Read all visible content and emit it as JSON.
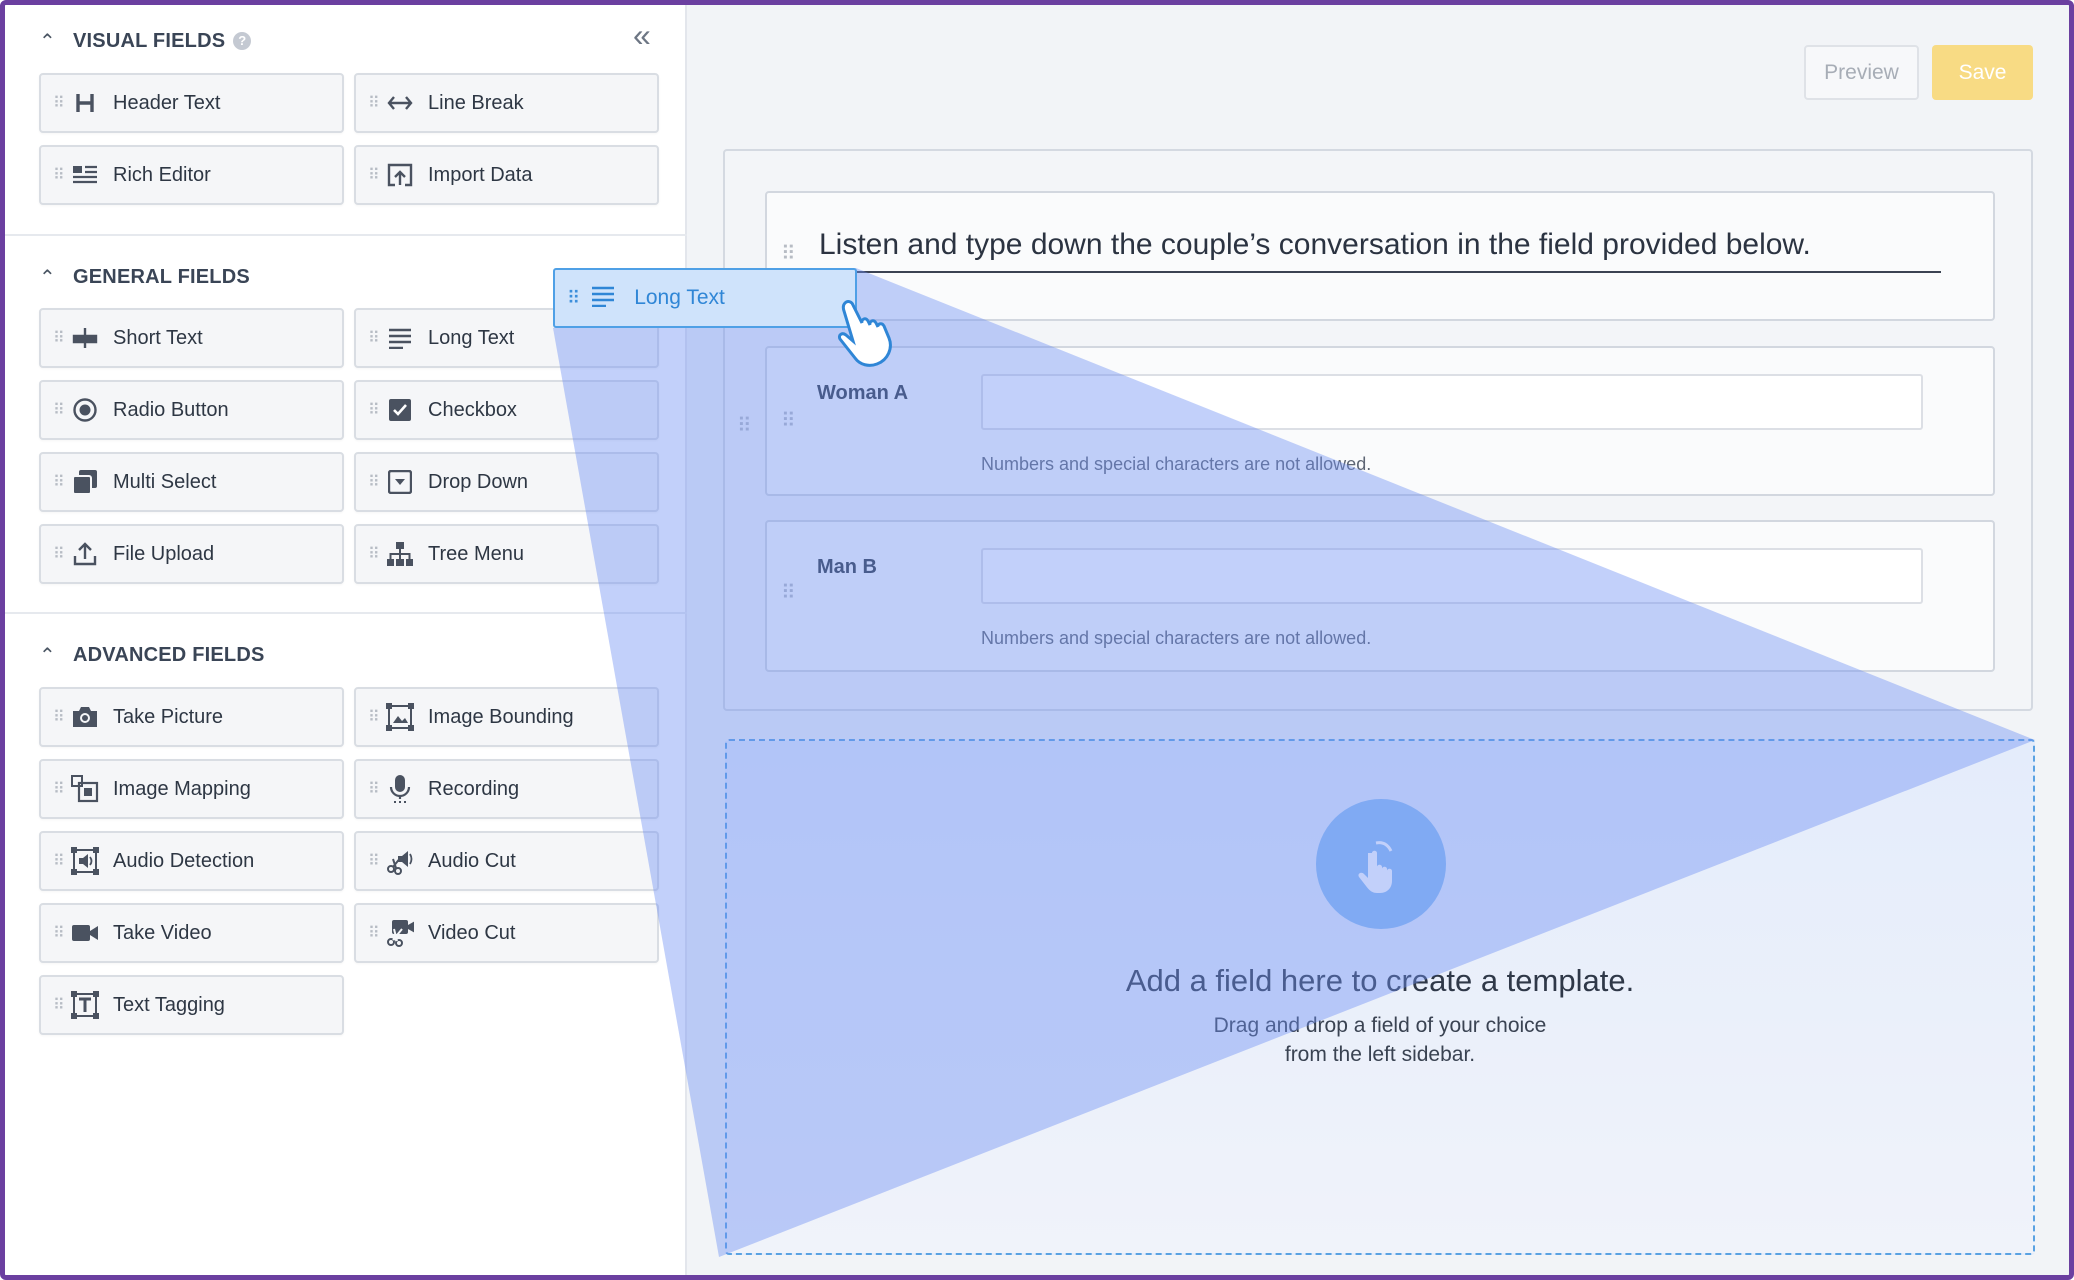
{
  "sidebar": {
    "collapse_icon": "double-chevron-left-icon",
    "visual": {
      "title": "VISUAL FIELDS",
      "help": "?",
      "items": [
        {
          "label": "Header Text",
          "icon": "header-icon"
        },
        {
          "label": "Line Break",
          "icon": "line-break-icon"
        },
        {
          "label": "Rich Editor",
          "icon": "rich-editor-icon"
        },
        {
          "label": "Import Data",
          "icon": "import-data-icon"
        }
      ]
    },
    "general": {
      "title": "GENERAL FIELDS",
      "items": [
        {
          "label": "Short Text",
          "icon": "short-text-icon"
        },
        {
          "label": "Long Text",
          "icon": "long-text-icon"
        },
        {
          "label": "Radio Button",
          "icon": "radio-icon"
        },
        {
          "label": "Checkbox",
          "icon": "checkbox-icon"
        },
        {
          "label": "Multi Select",
          "icon": "multi-select-icon"
        },
        {
          "label": "Drop Down",
          "icon": "drop-down-icon"
        },
        {
          "label": "File Upload",
          "icon": "file-upload-icon"
        },
        {
          "label": "Tree Menu",
          "icon": "tree-menu-icon"
        }
      ]
    },
    "advanced": {
      "title": "ADVANCED FIELDS",
      "items": [
        {
          "label": "Take Picture",
          "icon": "camera-icon"
        },
        {
          "label": "Image Bounding",
          "icon": "image-bounding-icon"
        },
        {
          "label": "Image Mapping",
          "icon": "image-mapping-icon"
        },
        {
          "label": "Recording",
          "icon": "microphone-icon"
        },
        {
          "label": "Audio Detection",
          "icon": "audio-detection-icon"
        },
        {
          "label": "Audio Cut",
          "icon": "audio-cut-icon"
        },
        {
          "label": "Take Video",
          "icon": "video-camera-icon"
        },
        {
          "label": "Video Cut",
          "icon": "video-cut-icon"
        },
        {
          "label": "Text Tagging",
          "icon": "text-tagging-icon"
        }
      ]
    }
  },
  "toolbar": {
    "preview_label": "Preview",
    "save_label": "Save"
  },
  "form": {
    "header_text": "Listen and type down the couple’s conversation in the field provided below.",
    "fields": [
      {
        "label": "Woman A",
        "value": "",
        "hint": "Numbers and special characters are not allowed."
      },
      {
        "label": "Man B",
        "value": "",
        "hint": "Numbers and special characters are not allowed."
      }
    ]
  },
  "drop_zone": {
    "title": "Add a field here to create a template.",
    "subtitle_line1": "Drag and drop a field of your choice",
    "subtitle_line2": "from the left sidebar."
  },
  "drag": {
    "label": "Long Text",
    "icon": "long-text-icon"
  },
  "colors": {
    "accent": "#4fa0e6",
    "save": "#f8db84",
    "drag_beam": "#6d8ff2"
  }
}
